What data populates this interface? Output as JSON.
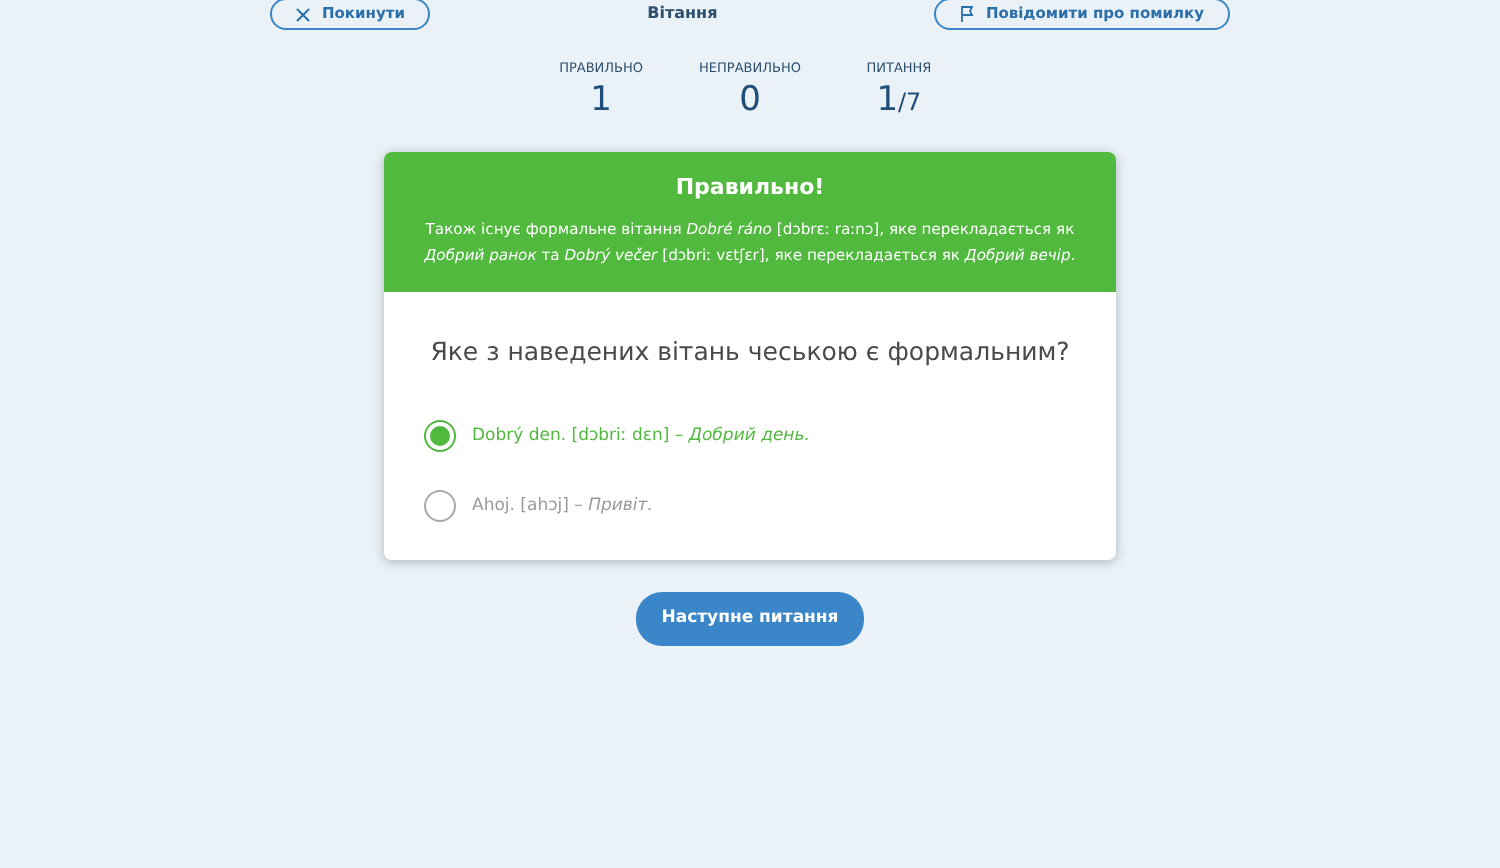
{
  "header": {
    "leave_button": "Покинути",
    "title": "Вітання",
    "report_button": "Повідомити про помилку"
  },
  "stats": [
    {
      "label": "ПРАВИЛЬНО",
      "value": "1"
    },
    {
      "label": "НЕПРАВИЛЬНО",
      "value": "0"
    },
    {
      "label": "ПИТАННЯ",
      "value": "1",
      "total": "/7"
    }
  ],
  "feedback": {
    "title": "Правильно!",
    "text": "Також існує формальне вітання *Dobré ráno* [dɔbrɛː raːnɔ], яке перекладається як *Добрий ранок* та *Dobrý večer* [dɔbriː vɛtʃɛr], яке перекладається як *Добрий вечір*."
  },
  "question": "Яке з наведених вітань чеською є формальним?",
  "options": [
    {
      "text": "Dobrý den. [dɔbriː dɛn] – *Добрий день.*",
      "selected": true
    },
    {
      "text": "Ahoj. [ahɔj] – *Привіт.*",
      "selected": false
    }
  ],
  "next_button": "Наступне питання"
}
